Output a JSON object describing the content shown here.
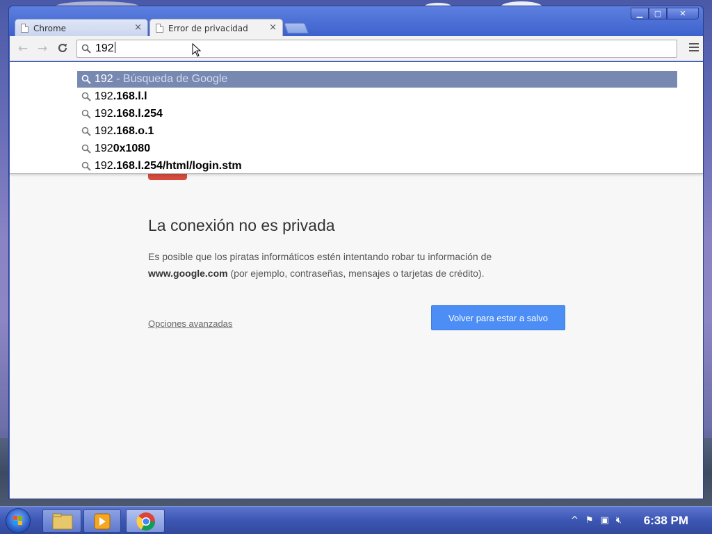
{
  "window": {
    "controls": {
      "minimize": "▁",
      "maximize": "▢",
      "close": "✕"
    }
  },
  "tabs": [
    {
      "label": "Chrome",
      "close": "×"
    },
    {
      "label": "Error de privacidad",
      "close": "×"
    }
  ],
  "toolbar": {
    "back_icon": "←",
    "forward_icon": "→",
    "reload_icon": "C",
    "omnibox_value": "192"
  },
  "suggestions": [
    {
      "prefix": "192",
      "rest": "",
      "desc": " - Búsqueda de Google",
      "selected": true
    },
    {
      "prefix": "192",
      "rest": ".168.l.l",
      "desc": "",
      "selected": false
    },
    {
      "prefix": "192",
      "rest": ".168.l.254",
      "desc": "",
      "selected": false
    },
    {
      "prefix": "192",
      "rest": ".168.o.1",
      "desc": "",
      "selected": false
    },
    {
      "prefix": "192",
      "rest": "0x1080",
      "desc": "",
      "selected": false
    },
    {
      "prefix": "192",
      "rest": ".168.l.254/html/login.stm",
      "desc": "",
      "selected": false
    }
  ],
  "error_page": {
    "title": "La conexión no es privada",
    "text_before": "Es posible que los piratas informáticos estén intentando robar tu información de ",
    "domain": "www.google.com",
    "text_after": " (por ejemplo, contraseñas, mensajes o tarjetas de crédito).",
    "advanced_link": "Opciones avanzadas",
    "back_button": "Volver para estar a salvo"
  },
  "taskbar": {
    "clock": "6:38 PM",
    "tray_up_arrow": "^"
  },
  "colors": {
    "selection": "#7889b1",
    "primary_button": "#4c8ef5",
    "error_red": "#d54b3d"
  }
}
